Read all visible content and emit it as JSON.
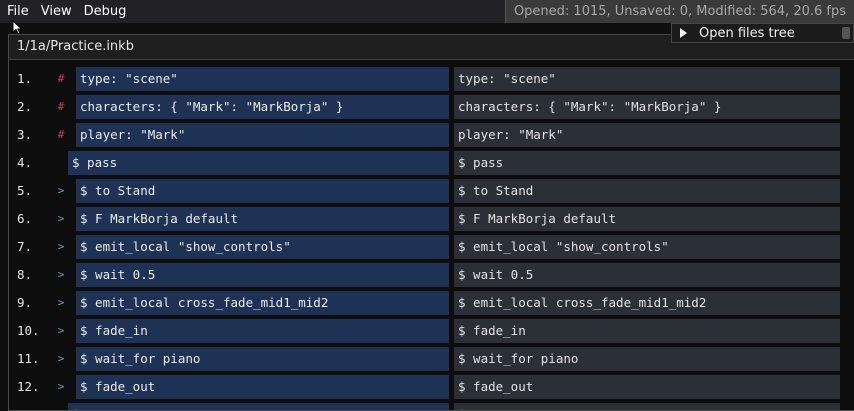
{
  "menu": {
    "file": "File",
    "view": "View",
    "debug": "Debug"
  },
  "status": "Opened: 1015, Unsaved: 0, Modified: 564, 20.6 fps",
  "window": {
    "title": "1/1a/Practice.inkb"
  },
  "popup": {
    "label": "Open files tree",
    "icon": "play-icon"
  },
  "rows": [
    {
      "num": "1.",
      "marker": "#",
      "left": "type: \"scene\"",
      "right": "type: \"scene\""
    },
    {
      "num": "2.",
      "marker": "#",
      "left": "characters: { \"Mark\": \"MarkBorja\" }",
      "right": "characters: { \"Mark\": \"MarkBorja\" }"
    },
    {
      "num": "3.",
      "marker": "#",
      "left": "player: \"Mark\"",
      "right": "player: \"Mark\""
    },
    {
      "num": "4.",
      "marker": "",
      "left": "$ pass",
      "right": "$ pass"
    },
    {
      "num": "5.",
      "marker": ">",
      "left": "$ to Stand",
      "right": "$ to Stand"
    },
    {
      "num": "6.",
      "marker": ">",
      "left": "$ F MarkBorja default",
      "right": "$ F MarkBorja default"
    },
    {
      "num": "7.",
      "marker": ">",
      "left": "$ emit_local \"show_controls\"",
      "right": "$ emit_local \"show_controls\""
    },
    {
      "num": "8.",
      "marker": ">",
      "left": "$ wait 0.5",
      "right": "$ wait 0.5"
    },
    {
      "num": "9.",
      "marker": ">",
      "left": "$ emit_local cross_fade_mid1_mid2",
      "right": "$ emit_local cross_fade_mid1_mid2"
    },
    {
      "num": "10.",
      "marker": ">",
      "left": "$ fade_in",
      "right": "$ fade_in"
    },
    {
      "num": "11.",
      "marker": ">",
      "left": "$ wait_for piano",
      "right": "$ wait_for piano"
    },
    {
      "num": "12.",
      "marker": ">",
      "left": "$ fade_out",
      "right": "$ fade_out"
    },
    {
      "num": "",
      "marker": "",
      "left": "$",
      "right": "$"
    }
  ],
  "colors": {
    "left_cell": "#1e3255",
    "right_cell": "#2b2f36",
    "hash_marker": "#c23b4a",
    "arrow_marker": "#4fb3a4"
  }
}
